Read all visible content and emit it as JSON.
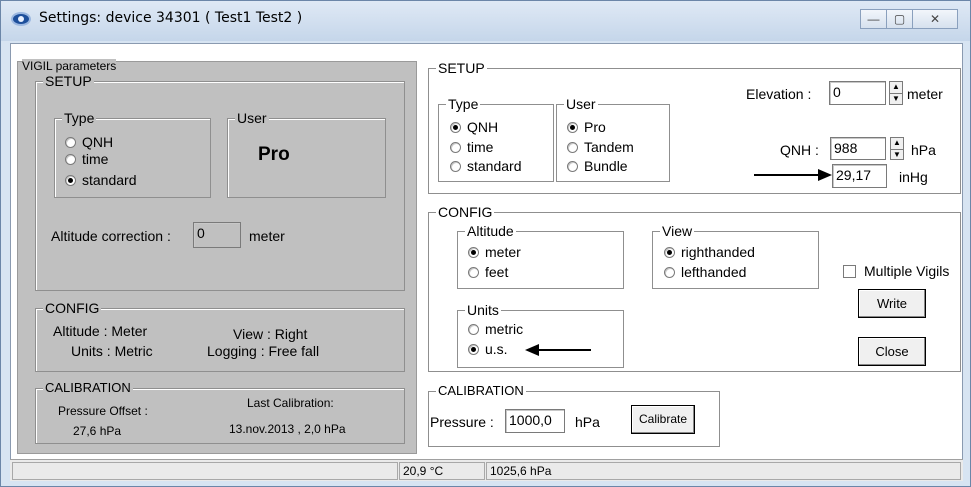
{
  "window": {
    "title": "Settings: device 34301 ( Test1   Test2   )",
    "min_glyph": "—",
    "max_glyph": "▢",
    "close_glyph": "✕"
  },
  "vigil": {
    "label": "VIGIL parameters",
    "setup": {
      "label": "SETUP",
      "type_label": "Type",
      "type_options": [
        "QNH",
        "time",
        "standard"
      ],
      "type_selected": "standard",
      "user_label": "User",
      "user_value": "Pro",
      "altitude_correction_label": "Altitude correction :",
      "altitude_correction_value": "0",
      "altitude_correction_unit": "meter"
    },
    "config": {
      "label": "CONFIG",
      "altitude_text": "Altitude : Meter",
      "units_text": "Units : Metric",
      "view_text": "View : Right",
      "logging_text": "Logging : Free fall"
    },
    "calibration": {
      "label": "CALIBRATION",
      "offset_label": "Pressure Offset :",
      "offset_value": "27,6  hPa",
      "last_label": "Last Calibration:",
      "last_value": "13.nov.2013  ,   2,0  hPa"
    }
  },
  "setup": {
    "label": "SETUP",
    "type_label": "Type",
    "type_options": [
      "QNH",
      "time",
      "standard"
    ],
    "type_selected": "QNH",
    "user_label": "User",
    "user_options": [
      "Pro",
      "Tandem",
      "Bundle"
    ],
    "user_selected": "Pro",
    "elevation_label": "Elevation :",
    "elevation_value": "0",
    "elevation_unit": "meter",
    "qnh_label": "QNH :",
    "qnh_value": "988",
    "qnh_unit": "hPa",
    "inhg_value": "29,17",
    "inhg_unit": "inHg"
  },
  "config": {
    "label": "CONFIG",
    "altitude_label": "Altitude",
    "altitude_options": [
      "meter",
      "feet"
    ],
    "altitude_selected": "meter",
    "view_label": "View",
    "view_options": [
      "righthanded",
      "lefthanded"
    ],
    "view_selected": "righthanded",
    "units_label": "Units",
    "units_options": [
      "metric",
      "u.s."
    ],
    "units_selected": "u.s.",
    "multiple_vigils_label": "Multiple Vigils",
    "multiple_vigils_checked": false
  },
  "buttons": {
    "write_label": "Write",
    "close_label": "Close",
    "calibrate_label": "Calibrate"
  },
  "calibration": {
    "label": "CALIBRATION",
    "pressure_label": "Pressure :",
    "pressure_value": "1000,0",
    "pressure_unit": "hPa"
  },
  "status": {
    "temperature": "20,9 °C",
    "pressure": "1025,6 hPa"
  },
  "colors": {
    "left_panel_bg": "#c0c0c0",
    "titlebar_bg": "#d7e4f2",
    "annotation_arrow": "#000000"
  }
}
